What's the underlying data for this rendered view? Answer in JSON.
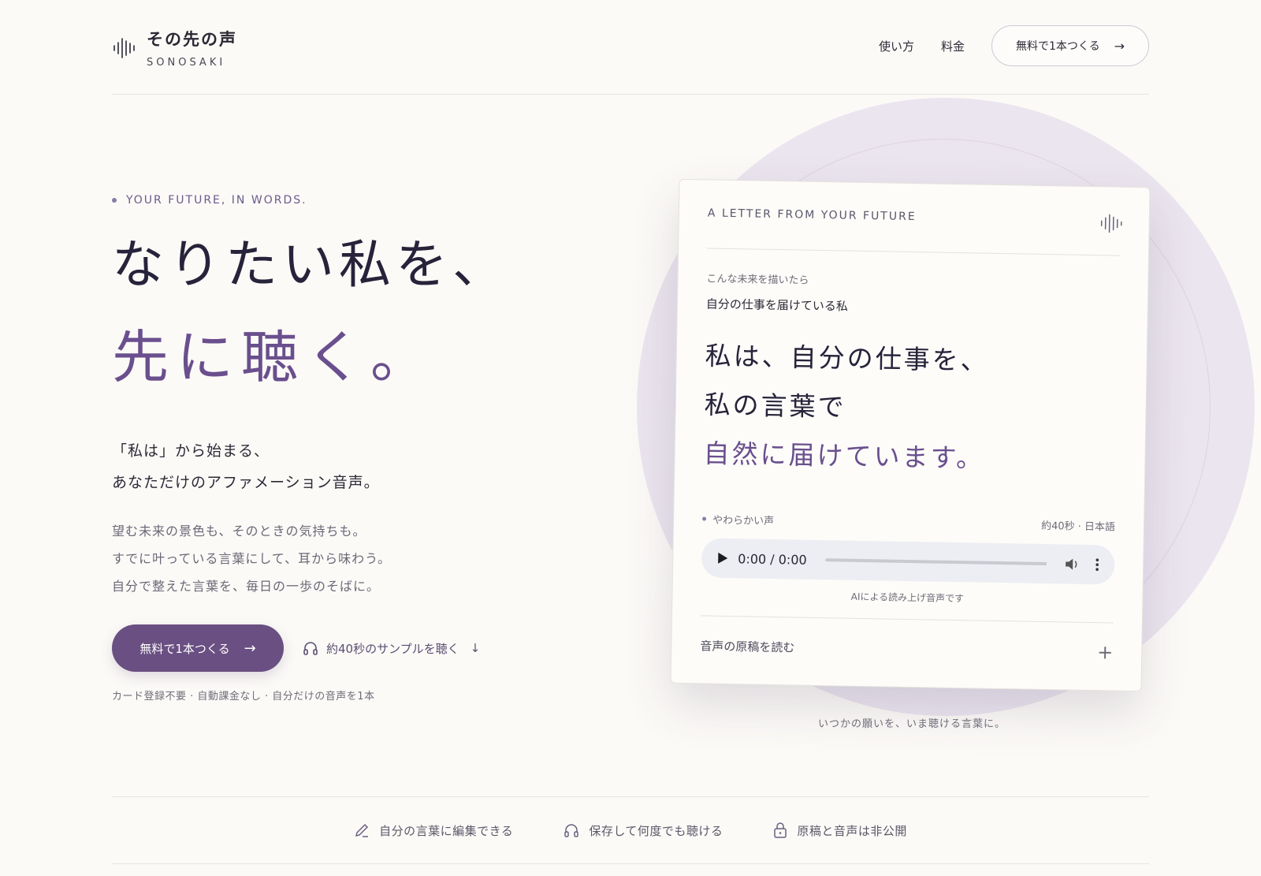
{
  "brand": {
    "title": "その先の声",
    "subtitle": "SONOSAKI"
  },
  "nav": {
    "items": [
      {
        "label": "使い方"
      },
      {
        "label": "料金"
      }
    ],
    "cta_label": "無料で1本つくる"
  },
  "hero": {
    "eyebrow": "YOUR FUTURE, IN WORDS.",
    "headline_line1": "なりたい私を、",
    "headline_line2": "先に聴く。",
    "lead_line1": "「私は」から始まる、",
    "lead_line2": "あなただけのアファメーション音声。",
    "body_line1": "望む未来の景色も、そのときの気持ちも。",
    "body_line2": "すでに叶っている言葉にして、耳から味わう。",
    "body_line3": "自分で整えた言葉を、毎日の一歩のそばに。",
    "cta_label": "無料で1本つくる",
    "sample_label": "約40秒のサンプルを聴く",
    "note": "カード登録不要 · 自動課金なし · 自分だけの音声を1本"
  },
  "card": {
    "eyebrow": "A LETTER FROM YOUR FUTURE",
    "label": "こんな未来を描いたら",
    "subtitle": "自分の仕事を届けている私",
    "quote_line1": "私は、自分の仕事を、",
    "quote_line2": "私の言葉で",
    "quote_line3": "自然に届けています。",
    "voice_label": "やわらかい声",
    "voice_meta": "約40秒 · 日本語",
    "player_time": "0:00 / 0:00",
    "ai_note": "AIによる読み上げ音声です",
    "script_label": "音声の原稿を読む"
  },
  "circle_caption": "いつかの願いを、いま聴ける言葉に。",
  "features": [
    {
      "label": "自分の言葉に編集できる",
      "icon": "pencil-icon"
    },
    {
      "label": "保存して何度でも聴ける",
      "icon": "headphones-icon"
    },
    {
      "label": "原稿と音声は非公開",
      "icon": "lock-icon"
    }
  ],
  "colors": {
    "accent": "#6a4f82",
    "accent_text": "#6a4f8e",
    "background": "#fcfaf7",
    "circle": "#ebe5ef"
  }
}
